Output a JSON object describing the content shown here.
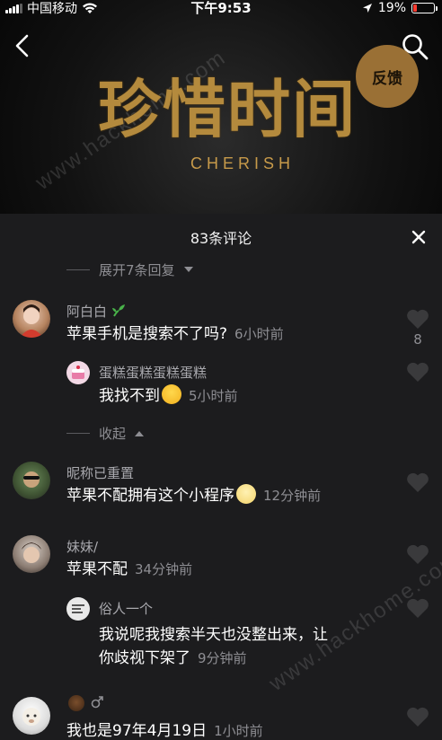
{
  "status": {
    "carrier": "中国移动",
    "time": "下午9:53",
    "battery_text": "19%",
    "battery_level": 0.19,
    "battery_color": "#ff3b30"
  },
  "banner": {
    "title": "珍惜时间",
    "subtitle": "CHERISH",
    "feedback_label": "反馈",
    "watermark": "www.hackhome.com"
  },
  "sheet": {
    "header": "83条评论",
    "expand_label": "展开7条回复",
    "collapse_label": "收起"
  },
  "comments": [
    {
      "name": "阿白白",
      "name_icon": "sprout-icon",
      "text": "苹果手机是搜索不了吗?",
      "time": "6小时前",
      "likes": "8"
    },
    {
      "name": "蛋糕蛋糕蛋糕蛋糕",
      "text": "我找不到",
      "emoji": "laugh-cry-emoji",
      "time": "5小时前",
      "reply": true
    },
    {
      "name": "昵称已重置",
      "text": "苹果不配拥有这个小程序",
      "emoji": "pleading-emoji",
      "time": "12分钟前"
    },
    {
      "name": "妹妹/",
      "text": "苹果不配",
      "time": "34分钟前"
    },
    {
      "name": "俗人一个",
      "text_line1": "我说呢我搜索半天也没整出来，让",
      "text_line2": "你歧视下架了",
      "time": "9分钟前",
      "reply": true
    },
    {
      "name_icons": [
        "face-emoji",
        "male-icon"
      ],
      "text": "我也是97年4月19日",
      "time": "1小时前"
    }
  ],
  "colors": {
    "sheet_bg": "#1c1c1e",
    "accent_gold": "#b48a3d",
    "muted_text": "#8e8e93",
    "like_icon": "#3a3a3c"
  }
}
